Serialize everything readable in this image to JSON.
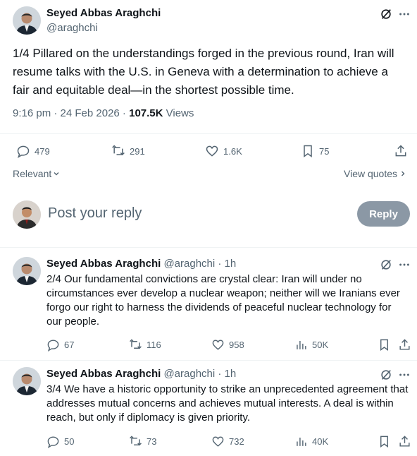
{
  "main_post": {
    "author_name": "Seyed Abbas Araghchi",
    "handle": "@araghchi",
    "text": "1/4 Pillared on the understandings forged in the previous round, Iran will resume talks with the U.S. in Geneva with a determination to achieve a fair and equitable deal—in the shortest possible time.",
    "time": "9:16 pm · 24 Feb 2026 · ",
    "views_count": "107.5K",
    "views_label": " Views",
    "replies": "479",
    "reposts": "291",
    "likes": "1.6K",
    "bookmarks": "75"
  },
  "sort": {
    "relevant_label": "Relevant",
    "view_quotes_label": "View quotes"
  },
  "composer": {
    "placeholder": "Post your reply",
    "reply_button": "Reply"
  },
  "replies": [
    {
      "author_name": "Seyed Abbas Araghchi",
      "handle_time": "@araghchi · 1h",
      "text": "2/4 Our fundamental convictions are crystal clear: Iran will under no circumstances ever develop a nuclear weapon; neither will we Iranians ever forgo our right to harness the dividends of peaceful nuclear technology for our people.",
      "replies": "67",
      "reposts": "116",
      "likes": "958",
      "views": "50K"
    },
    {
      "author_name": "Seyed Abbas Araghchi",
      "handle_time": "@araghchi · 1h",
      "text": "3/4 We have a historic opportunity to strike an unprecedented agreement that addresses mutual concerns and achieves mutual interests. A deal is within reach, but only if diplomacy is given priority.",
      "replies": "50",
      "reposts": "73",
      "likes": "732",
      "views": "40K"
    }
  ],
  "colors": {
    "text": "#0f1419",
    "muted": "#536471",
    "divider": "#eff3f4",
    "reply_button_bg": "#8b98a5"
  }
}
